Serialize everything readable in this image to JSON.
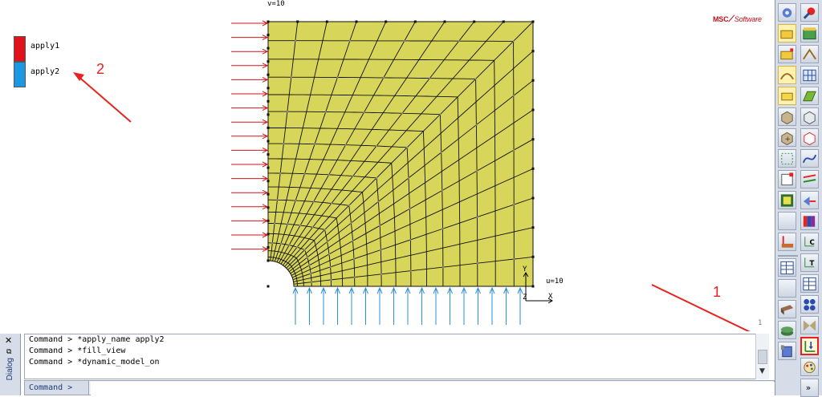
{
  "brand": {
    "name": "MSC",
    "sub": "Software"
  },
  "legend": [
    {
      "label": "apply1",
      "color": "#e0121c"
    },
    {
      "label": "apply2",
      "color": "#1a98e2"
    }
  ],
  "annotations": {
    "one": "1",
    "two": "2",
    "color": "#e8231f"
  },
  "model": {
    "fill_color": "#d7d55a",
    "v_label": "v=10",
    "u_label": "u=10",
    "axis_y": "Y",
    "axis_x": "X",
    "axis_z": "Z",
    "load_left_color": "#d0161b",
    "load_bottom_color": "#2b8fd6",
    "corner_mark": "1"
  },
  "dialog": {
    "title": "Dialog",
    "close": "✕",
    "restore": "⧉"
  },
  "console": {
    "lines": [
      "Command > *apply_name apply2",
      "Command > *fill_view",
      "Command > *dynamic_model_on"
    ]
  },
  "prompt": {
    "label": "Command >",
    "value": ""
  },
  "toolbar": {
    "left": [
      "gear-icon",
      "folder-icon",
      "folder-plus-icon",
      "arc-icon",
      "rect-icon",
      "cube-icon",
      "cube-plus-icon",
      "mesh-nodes-icon",
      "select-box-icon",
      "cube-green-icon",
      "blank",
      "contact-bar-icon",
      "sep",
      "table-icon",
      "blank",
      "beam-icon",
      "layers-icon",
      "database-icon"
    ],
    "right": [
      "rocket-icon",
      "green-box-icon",
      "arc-up-icon",
      "grid-icon",
      "green-surface-icon",
      "cube-outline-icon",
      "red-cube-icon",
      "curve-icon",
      "beams-icon",
      "move-icon",
      "color-bars-icon",
      "coord-c-icon",
      "coord-t-icon",
      "table-icon",
      "spheres-icon",
      "bow-icon",
      "load-apply-icon",
      "palette-icon",
      "more-icon"
    ]
  }
}
